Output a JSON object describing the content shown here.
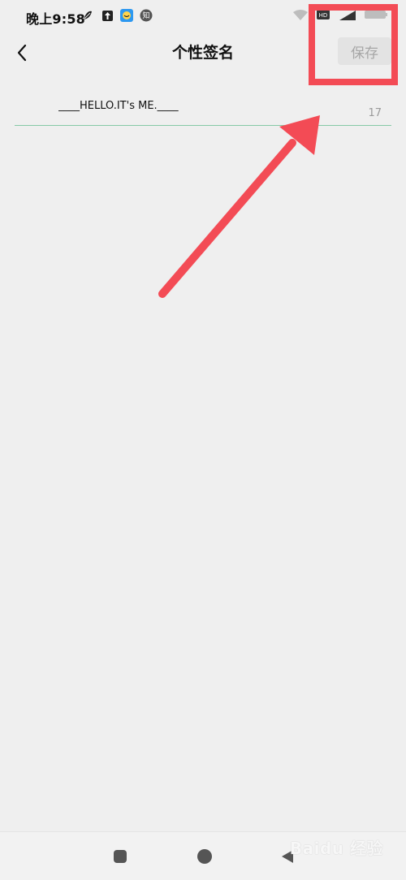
{
  "status_bar": {
    "time": "晚上9:58",
    "left_icons": [
      "leaf-icon",
      "upload-icon",
      "app-icon",
      "zhi-icon"
    ],
    "zhi_label": "知",
    "right_icons": [
      "wifi-icon",
      "hd-icon",
      "signal-icon",
      "battery-icon"
    ],
    "hd_label": "HD"
  },
  "header": {
    "title": "个性签名",
    "save_label": "保存",
    "back_icon": "chevron-left-icon"
  },
  "signature": {
    "value": "____HELLO.IT's ME.____",
    "char_count": "17"
  },
  "nav_bar": {
    "items": [
      "recent-apps-icon",
      "home-icon",
      "back-triangle-icon"
    ]
  },
  "watermark": {
    "text": "Baidu 经验"
  },
  "colors": {
    "background": "#efefef",
    "accent_line": "#86c9a6",
    "annotation": "#f34b55",
    "save_disabled_bg": "#e3e3e3",
    "save_disabled_text": "#a6a6a6"
  }
}
